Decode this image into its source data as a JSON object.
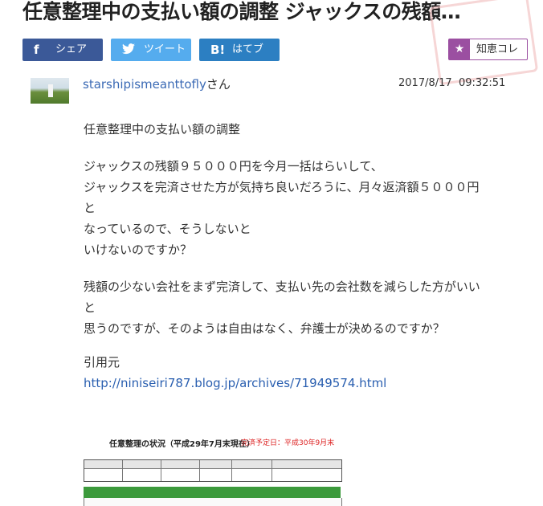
{
  "page": {
    "title": "任意整理中の支払い額の調整 ジャックスの残額…"
  },
  "share": {
    "facebook": {
      "icon": "facebook-icon",
      "label": "シェア"
    },
    "twitter": {
      "icon": "twitter-bird-icon",
      "label": "ツイート"
    },
    "hatena": {
      "icon": "hatena-bookmark-icon",
      "icon_text": "B!",
      "label": "はてブ"
    },
    "chiebukuro": {
      "icon": "star-icon",
      "label": "知恵コレ"
    }
  },
  "post": {
    "username": "starshipismeanttofly",
    "honorific": "さん",
    "date": "2017/8/17",
    "time": "09:32:51",
    "question_title": "任意整理中の支払い額の調整",
    "para1": [
      "ジャックスの残額９５０００円を今月一括はらいして、",
      "ジャックスを完済させた方が気持ち良いだろうに、月々返済額５０００円",
      "と",
      "なっているので、そうしないと",
      "いけないのですか？"
    ],
    "para2": [
      "残額の少ない会社をまず完済して、支払い先の会社数を減らした方がいい",
      "と",
      "思うのですが、そのようは自由はなく、弁護士が決めるのですか？"
    ],
    "source_label": "引用元",
    "source_url": "http://niniseiri787.blog.jp/archives/71949574.html"
  },
  "attached_image": {
    "title": "任意整理の状況（平成29年7月末現在）",
    "subtitle": "完済予定日：平成30年9月末"
  }
}
